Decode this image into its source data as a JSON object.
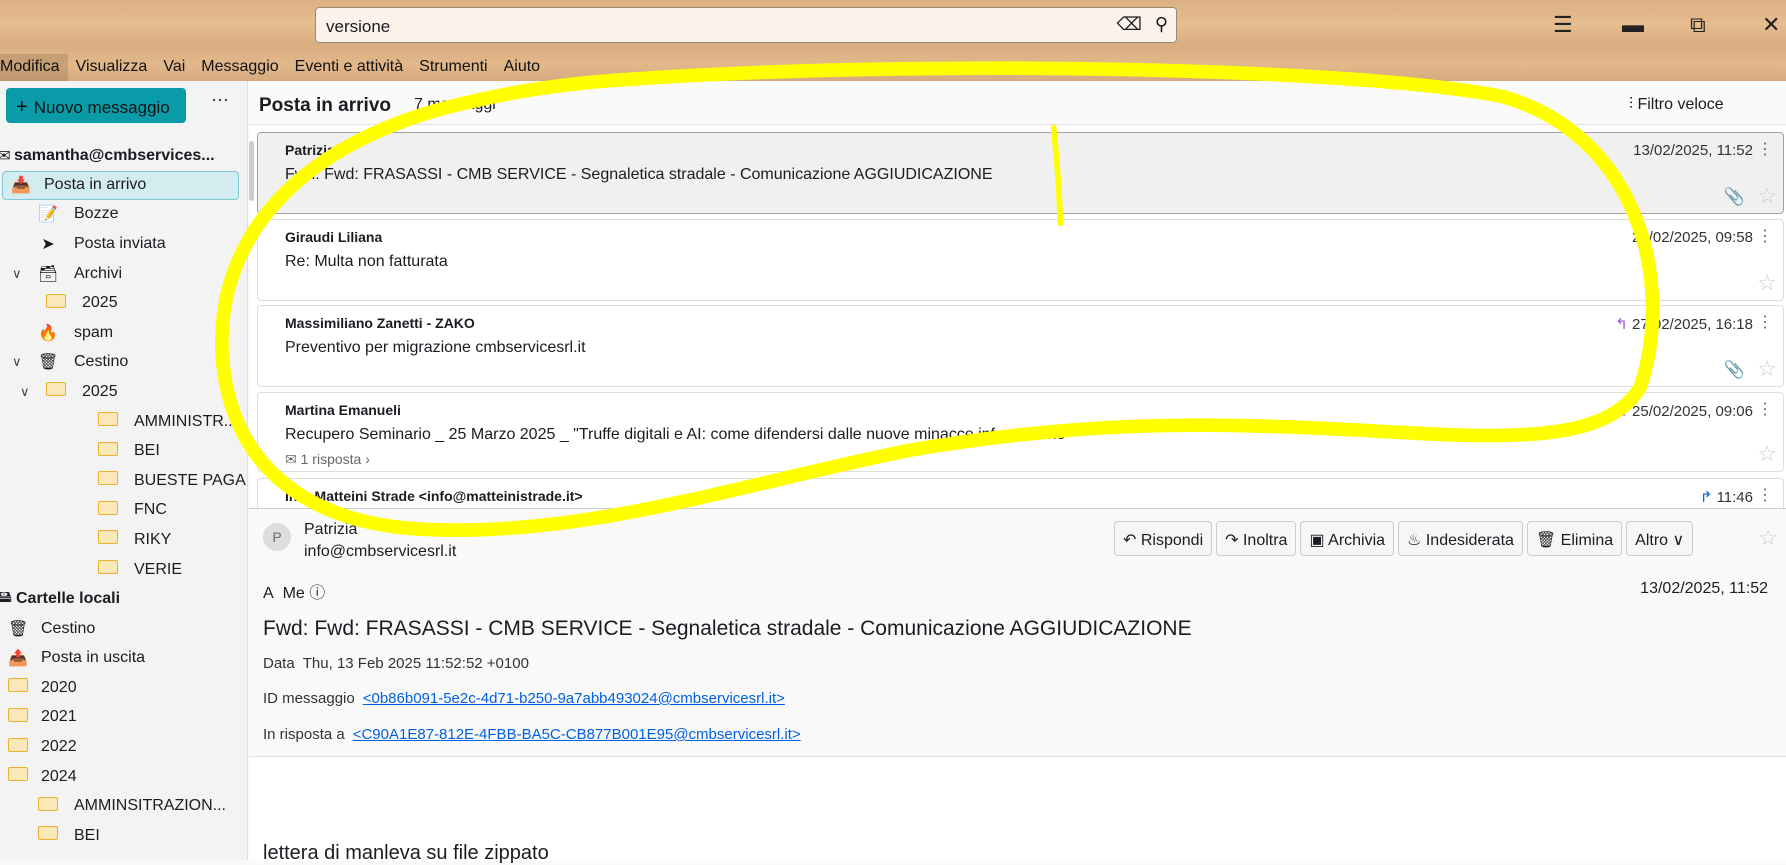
{
  "search": {
    "value": "versione",
    "clear_icon": "backspace-icon",
    "search_icon": "search-icon"
  },
  "window": {
    "menu_icon": "hamburger-icon",
    "minimize_icon": "minimize-icon",
    "restore_icon": "restore-icon",
    "close_icon": "close-icon"
  },
  "menu": [
    "Modifica",
    "Visualizza",
    "Vai",
    "Messaggio",
    "Eventi e attività",
    "Strumenti",
    "Aiuto"
  ],
  "sidebar": {
    "new_message": "Nuovo messaggio",
    "more": "···",
    "folders": [
      {
        "label": "samantha@cmbservices...",
        "icon": "account-icon",
        "bold": true
      },
      {
        "label": "Posta in arrivo",
        "icon": "inbox-icon",
        "selected": true
      },
      {
        "label": "Bozze",
        "icon": "drafts-icon"
      },
      {
        "label": "Posta inviata",
        "icon": "sent-icon"
      },
      {
        "label": "Archivi",
        "icon": "archive-icon",
        "expanded": true
      },
      {
        "label": "2025",
        "icon": "folder-icon"
      },
      {
        "label": "spam",
        "icon": "spam-icon"
      },
      {
        "label": "Cestino",
        "icon": "trash-icon",
        "expanded": true
      },
      {
        "label": "2025",
        "icon": "folder-icon",
        "expanded": true
      },
      {
        "label": "AMMINISTR...",
        "icon": "folder-icon"
      },
      {
        "label": "BEI",
        "icon": "folder-icon"
      },
      {
        "label": "BUESTE PAGA",
        "icon": "folder-icon"
      },
      {
        "label": "FNC",
        "icon": "folder-icon"
      },
      {
        "label": "RIKY",
        "icon": "folder-icon"
      },
      {
        "label": "VERIE",
        "icon": "folder-icon"
      },
      {
        "label": "Cartelle locali",
        "icon": "local-folders-icon",
        "bold": true
      },
      {
        "label": "Cestino",
        "icon": "trash-icon"
      },
      {
        "label": "Posta in uscita",
        "icon": "outbox-icon"
      },
      {
        "label": "2020",
        "icon": "folder-icon"
      },
      {
        "label": "2021",
        "icon": "folder-icon"
      },
      {
        "label": "2022",
        "icon": "folder-icon"
      },
      {
        "label": "2024",
        "icon": "folder-icon"
      },
      {
        "label": "AMMINSITRAZION...",
        "icon": "folder-icon"
      },
      {
        "label": "BEI",
        "icon": "folder-icon"
      }
    ]
  },
  "list": {
    "title": "Posta in arrivo",
    "count": "7 messaggi",
    "quick_filter": "Filtro veloce",
    "messages": [
      {
        "from": "Patrizia",
        "subject": "Fwd: Fwd: FRASASSI - CMB SERVICE - Segnaletica stradale - Comunicazione AGGIUDICAZIONE",
        "date": "13/02/2025, 11:52",
        "attachment": true,
        "selected": true
      },
      {
        "from": "Giraudi Liliana",
        "subject": "Re: Multa non fatturata",
        "date": "21/02/2025, 09:58"
      },
      {
        "from": "Massimiliano Zanetti - ZAKO",
        "subject": "Preventivo per migrazione cmbservicesrl.it",
        "date": "27/02/2025, 16:18",
        "replied": true,
        "attachment": true
      },
      {
        "from": "Martina Emanueli",
        "subject": "Recupero Seminario _ 25 Marzo 2025 _ \"Truffe digitali e AI: come difendersi dalle nuove minacce informatiche\"",
        "date": "25/02/2025, 09:06",
        "replied": true,
        "replies": "1 risposta"
      },
      {
        "from": "Info Matteini Strade <info@matteinistrade.it>",
        "date": "11:46",
        "forwarded": true
      }
    ]
  },
  "reader": {
    "avatar": "P",
    "from_name": "Patrizia",
    "from_addr": "info@cmbservicesrl.it",
    "buttons": [
      "Rispondi",
      "Inoltra",
      "Archivia",
      "Indesiderata",
      "Elimina",
      "Altro"
    ],
    "to_label": "A",
    "to": "Me",
    "date": "13/02/2025, 11:52",
    "subject": "Fwd: Fwd: FRASASSI - CMB SERVICE - Segnaletica stradale - Comunicazione AGGIUDICAZIONE",
    "data_label": "Data",
    "data_value": "Thu, 13 Feb 2025 11:52:52 +0100",
    "id_label": "ID messaggio",
    "id_value": "<0b86b091-5e2c-4d71-b250-9a7abb493024@cmbservicesrl.it>",
    "reply_label": "In risposta a",
    "reply_value": "<C90A1E87-812E-4FBB-BA5C-CB877B001E95@cmbservicesrl.it>",
    "body": "lettera di manleva su file zippato"
  },
  "colors": {
    "accent": "#0a9ba8",
    "link": "#0061e0",
    "annotation": "#ffff00",
    "reply": "#9a50e0",
    "forward": "#0061e0"
  }
}
